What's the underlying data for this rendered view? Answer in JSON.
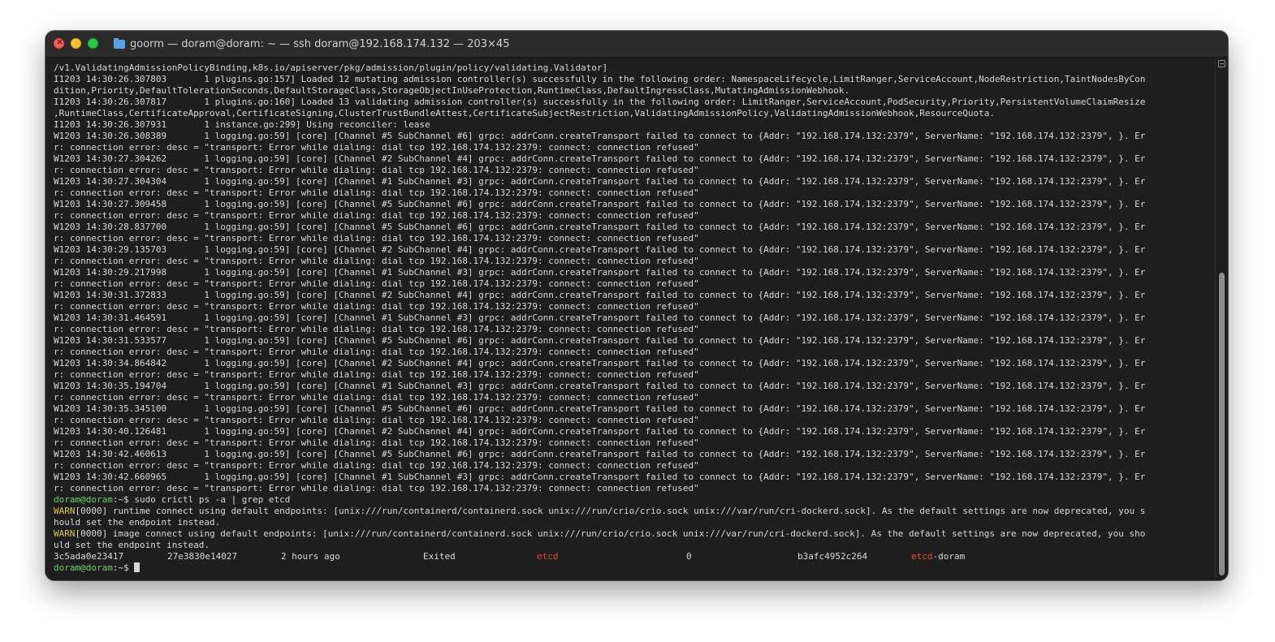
{
  "window": {
    "title": "goorm — doram@doram: ~ — ssh doram@192.168.174.132 — 203×45",
    "folder_icon": "folder-icon",
    "colors": {
      "background": "#1e1e1e",
      "text": "#d8d8d8",
      "prompt": "#6bcf6b",
      "warn": "#d6c84d",
      "highlight": "#e8473c"
    }
  },
  "log_lines": [
    "/v1.ValidatingAdmissionPolicyBinding,k8s.io/apiserver/pkg/admission/plugin/policy/validating.Validator]",
    "I1203 14:30:26.307803       1 plugins.go:157] Loaded 12 mutating admission controller(s) successfully in the following order: NamespaceLifecycle,LimitRanger,ServiceAccount,NodeRestriction,TaintNodesByCon",
    "dition,Priority,DefaultTolerationSeconds,DefaultStorageClass,StorageObjectInUseProtection,RuntimeClass,DefaultIngressClass,MutatingAdmissionWebhook.",
    "I1203 14:30:26.307817       1 plugins.go:160] Loaded 13 validating admission controller(s) successfully in the following order: LimitRanger,ServiceAccount,PodSecurity,Priority,PersistentVolumeClaimResize",
    ",RuntimeClass,CertificateApproval,CertificateSigning,ClusterTrustBundleAttest,CertificateSubjectRestriction,ValidatingAdmissionPolicy,ValidatingAdmissionWebhook,ResourceQuota.",
    "I1203 14:30:26.307931       1 instance.go:299] Using reconciler: lease",
    "W1203 14:30:26.308389       1 logging.go:59] [core] [Channel #5 SubChannel #6] grpc: addrConn.createTransport failed to connect to {Addr: \"192.168.174.132:2379\", ServerName: \"192.168.174.132:2379\", }. Er",
    "r: connection error: desc = \"transport: Error while dialing: dial tcp 192.168.174.132:2379: connect: connection refused\"",
    "W1203 14:30:27.304262       1 logging.go:59] [core] [Channel #2 SubChannel #4] grpc: addrConn.createTransport failed to connect to {Addr: \"192.168.174.132:2379\", ServerName: \"192.168.174.132:2379\", }. Er",
    "r: connection error: desc = \"transport: Error while dialing: dial tcp 192.168.174.132:2379: connect: connection refused\"",
    "W1203 14:30:27.304304       1 logging.go:59] [core] [Channel #1 SubChannel #3] grpc: addrConn.createTransport failed to connect to {Addr: \"192.168.174.132:2379\", ServerName: \"192.168.174.132:2379\", }. Er",
    "r: connection error: desc = \"transport: Error while dialing: dial tcp 192.168.174.132:2379: connect: connection refused\"",
    "W1203 14:30:27.309458       1 logging.go:59] [core] [Channel #5 SubChannel #6] grpc: addrConn.createTransport failed to connect to {Addr: \"192.168.174.132:2379\", ServerName: \"192.168.174.132:2379\", }. Er",
    "r: connection error: desc = \"transport: Error while dialing: dial tcp 192.168.174.132:2379: connect: connection refused\"",
    "W1203 14:30:28.837700       1 logging.go:59] [core] [Channel #5 SubChannel #6] grpc: addrConn.createTransport failed to connect to {Addr: \"192.168.174.132:2379\", ServerName: \"192.168.174.132:2379\", }. Er",
    "r: connection error: desc = \"transport: Error while dialing: dial tcp 192.168.174.132:2379: connect: connection refused\"",
    "W1203 14:30:29.135703       1 logging.go:59] [core] [Channel #2 SubChannel #4] grpc: addrConn.createTransport failed to connect to {Addr: \"192.168.174.132:2379\", ServerName: \"192.168.174.132:2379\", }. Er",
    "r: connection error: desc = \"transport: Error while dialing: dial tcp 192.168.174.132:2379: connect: connection refused\"",
    "W1203 14:30:29.217998       1 logging.go:59] [core] [Channel #1 SubChannel #3] grpc: addrConn.createTransport failed to connect to {Addr: \"192.168.174.132:2379\", ServerName: \"192.168.174.132:2379\", }. Er",
    "r: connection error: desc = \"transport: Error while dialing: dial tcp 192.168.174.132:2379: connect: connection refused\"",
    "W1203 14:30:31.372833       1 logging.go:59] [core] [Channel #2 SubChannel #4] grpc: addrConn.createTransport failed to connect to {Addr: \"192.168.174.132:2379\", ServerName: \"192.168.174.132:2379\", }. Er",
    "r: connection error: desc = \"transport: Error while dialing: dial tcp 192.168.174.132:2379: connect: connection refused\"",
    "W1203 14:30:31.464591       1 logging.go:59] [core] [Channel #1 SubChannel #3] grpc: addrConn.createTransport failed to connect to {Addr: \"192.168.174.132:2379\", ServerName: \"192.168.174.132:2379\", }. Er",
    "r: connection error: desc = \"transport: Error while dialing: dial tcp 192.168.174.132:2379: connect: connection refused\"",
    "W1203 14:30:31.533577       1 logging.go:59] [core] [Channel #5 SubChannel #6] grpc: addrConn.createTransport failed to connect to {Addr: \"192.168.174.132:2379\", ServerName: \"192.168.174.132:2379\", }. Er",
    "r: connection error: desc = \"transport: Error while dialing: dial tcp 192.168.174.132:2379: connect: connection refused\"",
    "W1203 14:30:34.864842       1 logging.go:59] [core] [Channel #2 SubChannel #4] grpc: addrConn.createTransport failed to connect to {Addr: \"192.168.174.132:2379\", ServerName: \"192.168.174.132:2379\", }. Er",
    "r: connection error: desc = \"transport: Error while dialing: dial tcp 192.168.174.132:2379: connect: connection refused\"",
    "W1203 14:30:35.194704       1 logging.go:59] [core] [Channel #1 SubChannel #3] grpc: addrConn.createTransport failed to connect to {Addr: \"192.168.174.132:2379\", ServerName: \"192.168.174.132:2379\", }. Er",
    "r: connection error: desc = \"transport: Error while dialing: dial tcp 192.168.174.132:2379: connect: connection refused\"",
    "W1203 14:30:35.345100       1 logging.go:59] [core] [Channel #5 SubChannel #6] grpc: addrConn.createTransport failed to connect to {Addr: \"192.168.174.132:2379\", ServerName: \"192.168.174.132:2379\", }. Er",
    "r: connection error: desc = \"transport: Error while dialing: dial tcp 192.168.174.132:2379: connect: connection refused\"",
    "W1203 14:30:40.126481       1 logging.go:59] [core] [Channel #2 SubChannel #4] grpc: addrConn.createTransport failed to connect to {Addr: \"192.168.174.132:2379\", ServerName: \"192.168.174.132:2379\", }. Er",
    "r: connection error: desc = \"transport: Error while dialing: dial tcp 192.168.174.132:2379: connect: connection refused\"",
    "W1203 14:30:42.460613       1 logging.go:59] [core] [Channel #5 SubChannel #6] grpc: addrConn.createTransport failed to connect to {Addr: \"192.168.174.132:2379\", ServerName: \"192.168.174.132:2379\", }. Er",
    "r: connection error: desc = \"transport: Error while dialing: dial tcp 192.168.174.132:2379: connect: connection refused\"",
    "W1203 14:30:42.660965       1 logging.go:59] [core] [Channel #1 SubChannel #3] grpc: addrConn.createTransport failed to connect to {Addr: \"192.168.174.132:2379\", ServerName: \"192.168.174.132:2379\", }. Er",
    "r: connection error: desc = \"transport: Error while dialing: dial tcp 192.168.174.132:2379: connect: connection refused\""
  ],
  "command": {
    "prompt": "doram@doram",
    "suffix": ":~$ ",
    "text": "sudo crictl ps -a | grep etcd"
  },
  "warnings": [
    {
      "tag": "WARN",
      "rest": "[0000] runtime connect using default endpoints: [unix:///run/containerd/containerd.sock unix:///run/crio/crio.sock unix:///var/run/cri-dockerd.sock]. As the default settings are now deprecated, you s",
      "cont": "hould set the endpoint instead."
    },
    {
      "tag": "WARN",
      "rest": "[0000] image connect using default endpoints: [unix:///run/containerd/containerd.sock unix:///run/crio/crio.sock unix:///var/run/cri-dockerd.sock]. As the default settings are now deprecated, you sho",
      "cont": "uld set the endpoint instead."
    }
  ],
  "container_row": {
    "container_id": "3c5ada0e23417",
    "image": "27e3830e14027",
    "created": "2 hours ago",
    "state": "Exited",
    "name": "etcd",
    "attempt": "0",
    "pod_id": "b3afc4952c264",
    "pod_match": "etcd",
    "pod_rest": "-doram"
  },
  "final_prompt": {
    "prompt": "doram@doram",
    "suffix": ":~$ "
  }
}
